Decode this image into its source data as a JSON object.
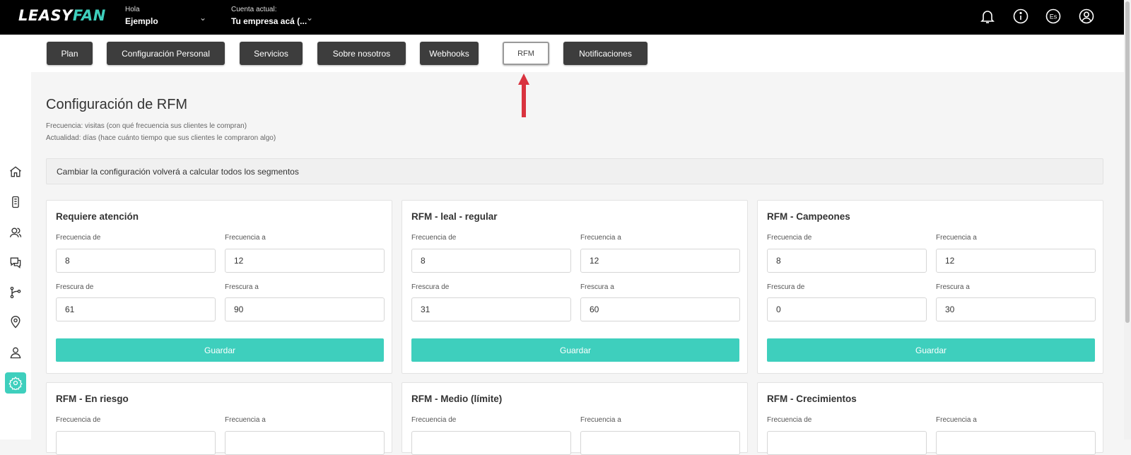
{
  "header": {
    "logo_left": "LEASY",
    "logo_right": "FAN",
    "greeting_caption": "Hola",
    "greeting_user": "Ejemplo",
    "account_caption": "Cuenta actual:",
    "account_value": "Tu empresa acá (...",
    "icons": [
      "bell-icon",
      "info-icon",
      "language-icon",
      "user-icon"
    ],
    "language_code": "Es"
  },
  "sidebar": {
    "items": [
      "home-icon",
      "device-icon",
      "users-icon",
      "chat-icon",
      "flow-icon",
      "location-icon",
      "contact-icon",
      "settings-icon"
    ],
    "active": "settings-icon"
  },
  "tabs": [
    {
      "label": "Plan",
      "active": false
    },
    {
      "label": "Configuración Personal",
      "active": false
    },
    {
      "label": "Servicios",
      "active": false
    },
    {
      "label": "Sobre nosotros",
      "active": false
    },
    {
      "label": "Webhooks",
      "active": false
    },
    {
      "label": "RFM",
      "active": true
    },
    {
      "label": "Notificaciones",
      "active": false
    }
  ],
  "page": {
    "title": "Configuración de RFM",
    "desc1": "Frecuencia: visitas (con qué frecuencia sus clientes le compran)",
    "desc2": "Actualidad: días (hace cuánto tiempo que sus clientes le compraron algo)",
    "notice": "Cambiar la configuración volverá a calcular todos los segmentos"
  },
  "labels": {
    "freq_from": "Frecuencia de",
    "freq_to": "Frecuencia a",
    "fresh_from": "Frescura de",
    "fresh_to": "Frescura a",
    "save": "Guardar"
  },
  "cards": [
    {
      "title": "Requiere atención",
      "freq_from": "8",
      "freq_to": "12",
      "fresh_from": "61",
      "fresh_to": "90"
    },
    {
      "title": "RFM - leal - regular",
      "freq_from": "8",
      "freq_to": "12",
      "fresh_from": "31",
      "fresh_to": "60"
    },
    {
      "title": "RFM - Campeones",
      "freq_from": "8",
      "freq_to": "12",
      "fresh_from": "0",
      "fresh_to": "30"
    },
    {
      "title": "RFM - En riesgo"
    },
    {
      "title": "RFM - Medio (límite)"
    },
    {
      "title": "RFM - Crecimientos"
    }
  ],
  "colors": {
    "accent": "#3ecfbd",
    "header_bg": "#000000",
    "tab_bg": "#3d3d3d",
    "arrow": "#d9333f"
  }
}
